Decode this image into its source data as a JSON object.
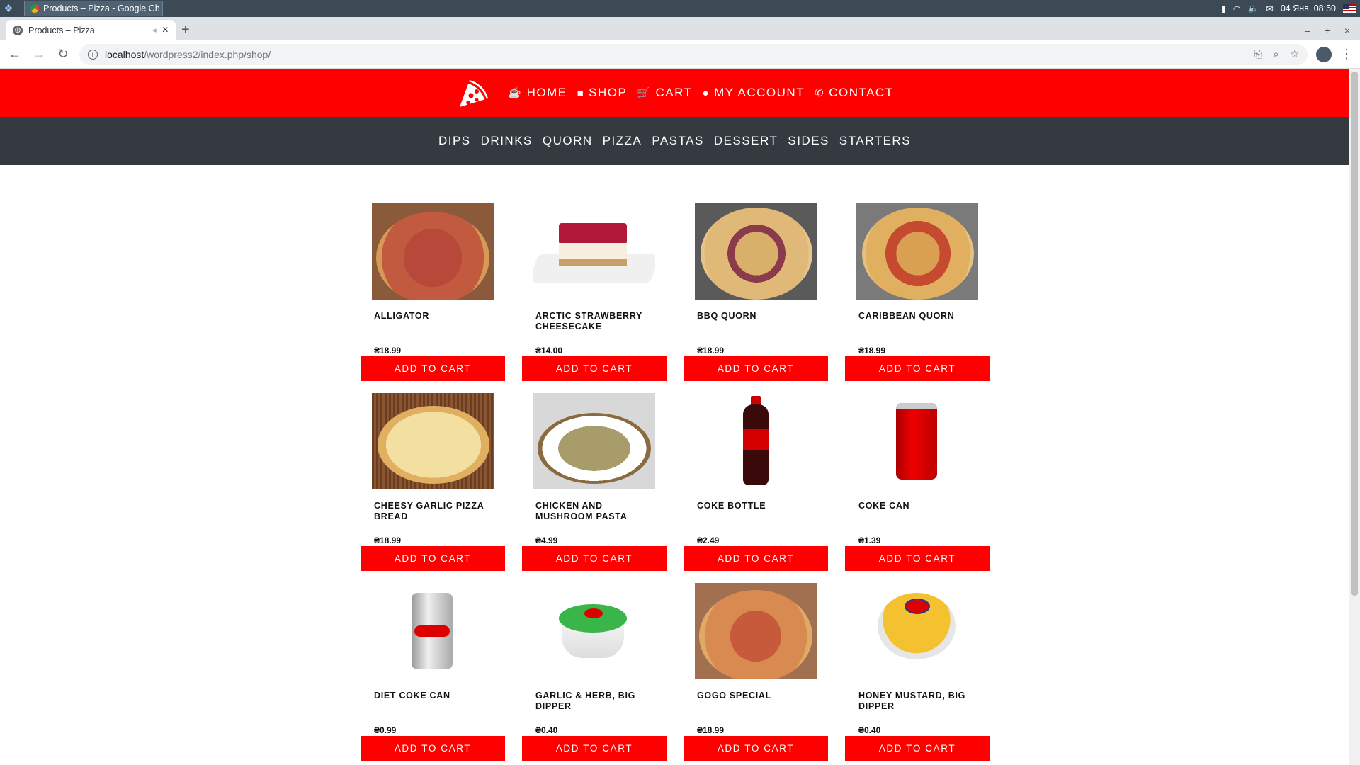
{
  "taskbar": {
    "window_title": "Products – Pizza - Google Ch...",
    "clock": "04 Янв, 08:50"
  },
  "browser": {
    "tab_title": "Products – Pizza",
    "url_host": "localhost",
    "url_path": "/wordpress2/index.php/shop/"
  },
  "nav": {
    "home": "HOME",
    "shop": "SHOP",
    "cart": "CART",
    "account": "MY ACCOUNT",
    "contact": "CONTACT"
  },
  "categories": [
    "DIPS",
    "DRINKS",
    "QUORN",
    "PIZZA",
    "PASTAS",
    "DESSERT",
    "SIDES",
    "STARTERS"
  ],
  "button_label": "ADD TO CART",
  "products": [
    {
      "name": "ALLIGATOR",
      "price": "₴18.99"
    },
    {
      "name": "ARCTIC STRAWBERRY CHEESECAKE",
      "price": "₴14.00"
    },
    {
      "name": "BBQ QUORN",
      "price": "₴18.99"
    },
    {
      "name": "CARIBBEAN QUORN",
      "price": "₴18.99"
    },
    {
      "name": "CHEESY GARLIC PIZZA BREAD",
      "price": "₴18.99"
    },
    {
      "name": "CHICKEN AND MUSHROOM PASTA",
      "price": "₴4.99"
    },
    {
      "name": "COKE BOTTLE",
      "price": "₴2.49"
    },
    {
      "name": "COKE CAN",
      "price": "₴1.39"
    },
    {
      "name": "DIET COKE CAN",
      "price": "₴0.99"
    },
    {
      "name": "GARLIC & HERB, BIG DIPPER",
      "price": "₴0.40"
    },
    {
      "name": "GOGO SPECIAL",
      "price": "₴18.99"
    },
    {
      "name": "HONEY MUSTARD, BIG DIPPER",
      "price": "₴0.40"
    }
  ],
  "colors": {
    "brand_red": "#ff0000",
    "dark_bar": "#343a40"
  }
}
